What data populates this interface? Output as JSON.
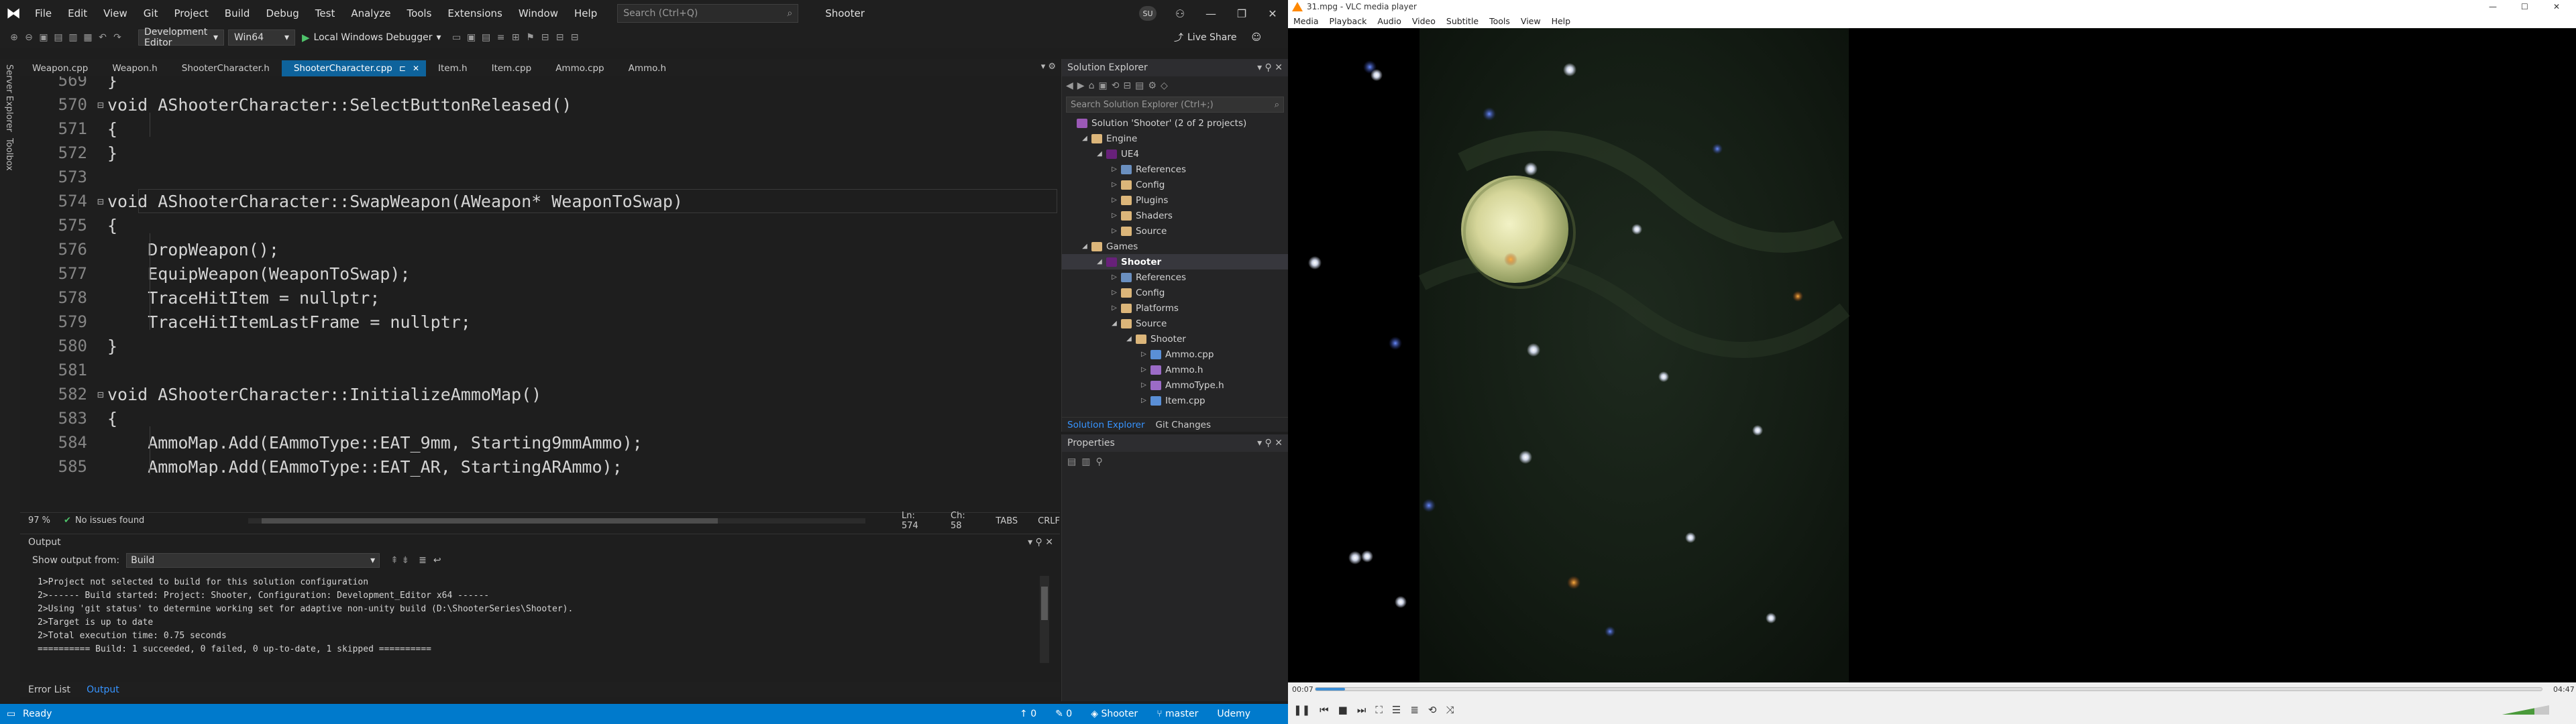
{
  "vs": {
    "menu": [
      "File",
      "Edit",
      "View",
      "Git",
      "Project",
      "Build",
      "Debug",
      "Test",
      "Analyze",
      "Tools",
      "Extensions",
      "Window",
      "Help"
    ],
    "search_placeholder": "Search (Ctrl+Q)",
    "project_name": "Shooter",
    "avatar": "SU",
    "toolbar": {
      "config": "Development Editor",
      "platform": "Win64",
      "debugger": "Local Windows Debugger",
      "live_share": "Live Share"
    },
    "side_tabs": [
      "Server Explorer",
      "Toolbox"
    ],
    "tabs": [
      "Weapon.cpp",
      "Weapon.h",
      "ShooterCharacter.h",
      "ShooterCharacter.cpp",
      "Item.h",
      "Item.cpp",
      "Ammo.cpp",
      "Ammo.h"
    ],
    "active_tab": "ShooterCharacter.cpp",
    "code": [
      {
        "ln": "569",
        "text": "}"
      },
      {
        "ln": "570",
        "text": "void AShooterCharacter::SelectButtonReleased()"
      },
      {
        "ln": "571",
        "text": "{"
      },
      {
        "ln": "572",
        "text": "}"
      },
      {
        "ln": "573",
        "text": ""
      },
      {
        "ln": "574",
        "text": "void AShooterCharacter::SwapWeapon(AWeapon* WeaponToSwap)"
      },
      {
        "ln": "575",
        "text": "{"
      },
      {
        "ln": "576",
        "text": "    DropWeapon();"
      },
      {
        "ln": "577",
        "text": "    EquipWeapon(WeaponToSwap);"
      },
      {
        "ln": "578",
        "text": "    TraceHitItem = nullptr;"
      },
      {
        "ln": "579",
        "text": "    TraceHitItemLastFrame = nullptr;"
      },
      {
        "ln": "580",
        "text": "}"
      },
      {
        "ln": "581",
        "text": ""
      },
      {
        "ln": "582",
        "text": "void AShooterCharacter::InitializeAmmoMap()"
      },
      {
        "ln": "583",
        "text": "{"
      },
      {
        "ln": "584",
        "text": "    AmmoMap.Add(EAmmoType::EAT_9mm, Starting9mmAmmo);"
      },
      {
        "ln": "585",
        "text": "    AmmoMap.Add(EAmmoType::EAT_AR, StartingARAmmo);"
      }
    ],
    "editor_status": {
      "zoom": "97 %",
      "issues": "No issues found",
      "ln": "Ln: 574",
      "ch": "Ch: 58",
      "tabs": "TABS",
      "eol": "CRLF"
    },
    "output": {
      "title": "Output",
      "show_from_label": "Show output from:",
      "source": "Build",
      "lines": [
        "1>Project not selected to build for this solution configuration",
        "2>------ Build started: Project: Shooter, Configuration: Development_Editor x64 ------",
        "2>Using 'git status' to determine working set for adaptive non-unity build (D:\\ShooterSeries\\Shooter).",
        "2>Target is up to date",
        "2>Total execution time: 0.75 seconds",
        "========== Build: 1 succeeded, 0 failed, 0 up-to-date, 1 skipped =========="
      ]
    },
    "bottom_tabs": [
      "Error List",
      "Output"
    ],
    "statusbar": {
      "ready": "Ready",
      "errors": "0",
      "warnings": "0",
      "project": "Shooter",
      "branch": "master",
      "extra": "Udemy"
    },
    "solution_explorer": {
      "title": "Solution Explorer",
      "search_placeholder": "Search Solution Explorer (Ctrl+;)",
      "tree": [
        {
          "depth": 0,
          "tw": "",
          "icon": "sln",
          "label": "Solution 'Shooter' (2 of 2 projects)"
        },
        {
          "depth": 1,
          "tw": "◢",
          "icon": "folder",
          "label": "Engine"
        },
        {
          "depth": 2,
          "tw": "◢",
          "icon": "proj",
          "label": "UE4"
        },
        {
          "depth": 3,
          "tw": "▷",
          "icon": "ref",
          "label": "References"
        },
        {
          "depth": 3,
          "tw": "▷",
          "icon": "folder",
          "label": "Config"
        },
        {
          "depth": 3,
          "tw": "▷",
          "icon": "folder",
          "label": "Plugins"
        },
        {
          "depth": 3,
          "tw": "▷",
          "icon": "folder",
          "label": "Shaders"
        },
        {
          "depth": 3,
          "tw": "▷",
          "icon": "folder",
          "label": "Source"
        },
        {
          "depth": 1,
          "tw": "◢",
          "icon": "folder",
          "label": "Games"
        },
        {
          "depth": 2,
          "tw": "◢",
          "icon": "proj",
          "label": "Shooter",
          "sel": true
        },
        {
          "depth": 3,
          "tw": "▷",
          "icon": "ref",
          "label": "References"
        },
        {
          "depth": 3,
          "tw": "▷",
          "icon": "folder",
          "label": "Config"
        },
        {
          "depth": 3,
          "tw": "▷",
          "icon": "folder",
          "label": "Platforms"
        },
        {
          "depth": 3,
          "tw": "◢",
          "icon": "folder",
          "label": "Source"
        },
        {
          "depth": 4,
          "tw": "◢",
          "icon": "folder",
          "label": "Shooter"
        },
        {
          "depth": 5,
          "tw": "▷",
          "icon": "cpp",
          "label": "Ammo.cpp"
        },
        {
          "depth": 5,
          "tw": "▷",
          "icon": "h",
          "label": "Ammo.h"
        },
        {
          "depth": 5,
          "tw": "▷",
          "icon": "h",
          "label": "AmmoType.h"
        },
        {
          "depth": 5,
          "tw": "▷",
          "icon": "cpp",
          "label": "Item.cpp"
        }
      ],
      "bottom_tabs": [
        "Solution Explorer",
        "Git Changes"
      ]
    },
    "properties": {
      "title": "Properties"
    }
  },
  "vlc": {
    "title": "31.mpg - VLC media player",
    "menu": [
      "Media",
      "Playback",
      "Audio",
      "Video",
      "Subtitle",
      "Tools",
      "View",
      "Help"
    ],
    "time_elapsed": "00:07",
    "time_total": "04:47",
    "progress": 0.024
  },
  "colors": {
    "vs_accent": "#007acc",
    "vs_tab_active": "#0e639c",
    "vlc_cone": "#ff8800"
  }
}
